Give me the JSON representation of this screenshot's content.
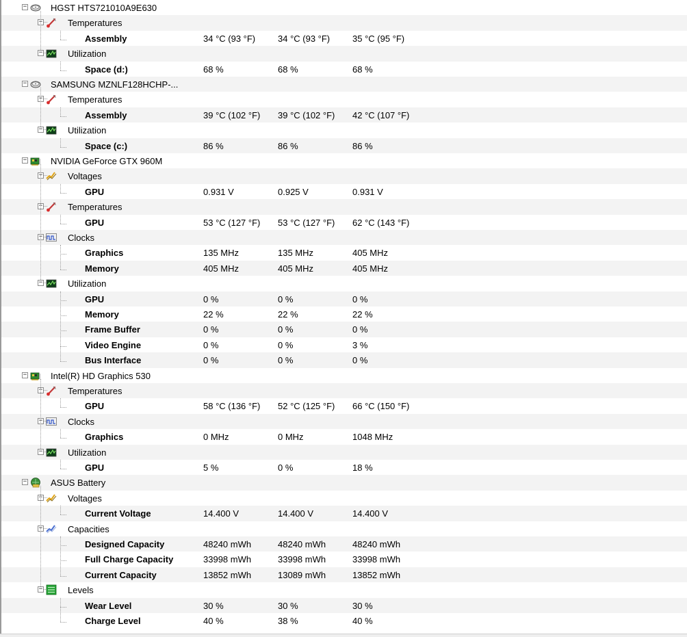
{
  "devices": [
    {
      "name": "HGST HTS721010A9E630",
      "icon": "hard-drive-icon",
      "groups": [
        {
          "label": "Temperatures",
          "icon": "thermometer-icon",
          "sensors": [
            {
              "label": "Assembly",
              "values": [
                "34 °C  (93 °F)",
                "34 °C  (93 °F)",
                "35 °C  (95 °F)"
              ]
            }
          ]
        },
        {
          "label": "Utilization",
          "icon": "utilization-icon",
          "sensors": [
            {
              "label": "Space (d:)",
              "values": [
                "68 %",
                "68 %",
                "68 %"
              ]
            }
          ]
        }
      ]
    },
    {
      "name": "SAMSUNG MZNLF128HCHP-...",
      "icon": "hard-drive-icon",
      "groups": [
        {
          "label": "Temperatures",
          "icon": "thermometer-icon",
          "sensors": [
            {
              "label": "Assembly",
              "values": [
                "39 °C  (102 °F)",
                "39 °C  (102 °F)",
                "42 °C  (107 °F)"
              ]
            }
          ]
        },
        {
          "label": "Utilization",
          "icon": "utilization-icon",
          "sensors": [
            {
              "label": "Space (c:)",
              "values": [
                "86 %",
                "86 %",
                "86 %"
              ]
            }
          ]
        }
      ]
    },
    {
      "name": "NVIDIA GeForce GTX 960M",
      "icon": "gpu-card-icon",
      "groups": [
        {
          "label": "Voltages",
          "icon": "voltage-icon",
          "sensors": [
            {
              "label": "GPU",
              "values": [
                "0.931 V",
                "0.925 V",
                "0.931 V"
              ]
            }
          ]
        },
        {
          "label": "Temperatures",
          "icon": "thermometer-icon",
          "sensors": [
            {
              "label": "GPU",
              "values": [
                "53 °C  (127 °F)",
                "53 °C  (127 °F)",
                "62 °C  (143 °F)"
              ]
            }
          ]
        },
        {
          "label": "Clocks",
          "icon": "clock-wave-icon",
          "sensors": [
            {
              "label": "Graphics",
              "values": [
                "135 MHz",
                "135 MHz",
                "405 MHz"
              ]
            },
            {
              "label": "Memory",
              "values": [
                "405 MHz",
                "405 MHz",
                "405 MHz"
              ]
            }
          ]
        },
        {
          "label": "Utilization",
          "icon": "utilization-icon",
          "sensors": [
            {
              "label": "GPU",
              "values": [
                "0 %",
                "0 %",
                "0 %"
              ]
            },
            {
              "label": "Memory",
              "values": [
                "22 %",
                "22 %",
                "22 %"
              ]
            },
            {
              "label": "Frame Buffer",
              "values": [
                "0 %",
                "0 %",
                "0 %"
              ]
            },
            {
              "label": "Video Engine",
              "values": [
                "0 %",
                "0 %",
                "3 %"
              ]
            },
            {
              "label": "Bus Interface",
              "values": [
                "0 %",
                "0 %",
                "0 %"
              ]
            }
          ]
        }
      ]
    },
    {
      "name": "Intel(R) HD Graphics 530",
      "icon": "gpu-card-icon",
      "groups": [
        {
          "label": "Temperatures",
          "icon": "thermometer-icon",
          "sensors": [
            {
              "label": "GPU",
              "values": [
                "58 °C  (136 °F)",
                "52 °C  (125 °F)",
                "66 °C  (150 °F)"
              ]
            }
          ]
        },
        {
          "label": "Clocks",
          "icon": "clock-wave-icon",
          "sensors": [
            {
              "label": "Graphics",
              "values": [
                "0 MHz",
                "0 MHz",
                "1048 MHz"
              ]
            }
          ]
        },
        {
          "label": "Utilization",
          "icon": "utilization-icon",
          "sensors": [
            {
              "label": "GPU",
              "values": [
                "5 %",
                "0 %",
                "18 %"
              ]
            }
          ]
        }
      ]
    },
    {
      "name": "ASUS Battery",
      "icon": "battery-icon",
      "groups": [
        {
          "label": "Voltages",
          "icon": "voltage-icon",
          "sensors": [
            {
              "label": "Current Voltage",
              "values": [
                "14.400 V",
                "14.400 V",
                "14.400 V"
              ]
            }
          ]
        },
        {
          "label": "Capacities",
          "icon": "capacity-icon",
          "sensors": [
            {
              "label": "Designed Capacity",
              "values": [
                "48240 mWh",
                "48240 mWh",
                "48240 mWh"
              ]
            },
            {
              "label": "Full Charge Capacity",
              "values": [
                "33998 mWh",
                "33998 mWh",
                "33998 mWh"
              ]
            },
            {
              "label": "Current Capacity",
              "values": [
                "13852 mWh",
                "13089 mWh",
                "13852 mWh"
              ]
            }
          ]
        },
        {
          "label": "Levels",
          "icon": "levels-icon",
          "sensors": [
            {
              "label": "Wear Level",
              "values": [
                "30 %",
                "30 %",
                "30 %"
              ]
            },
            {
              "label": "Charge Level",
              "values": [
                "40 %",
                "38 %",
                "40 %"
              ]
            }
          ]
        }
      ]
    }
  ]
}
